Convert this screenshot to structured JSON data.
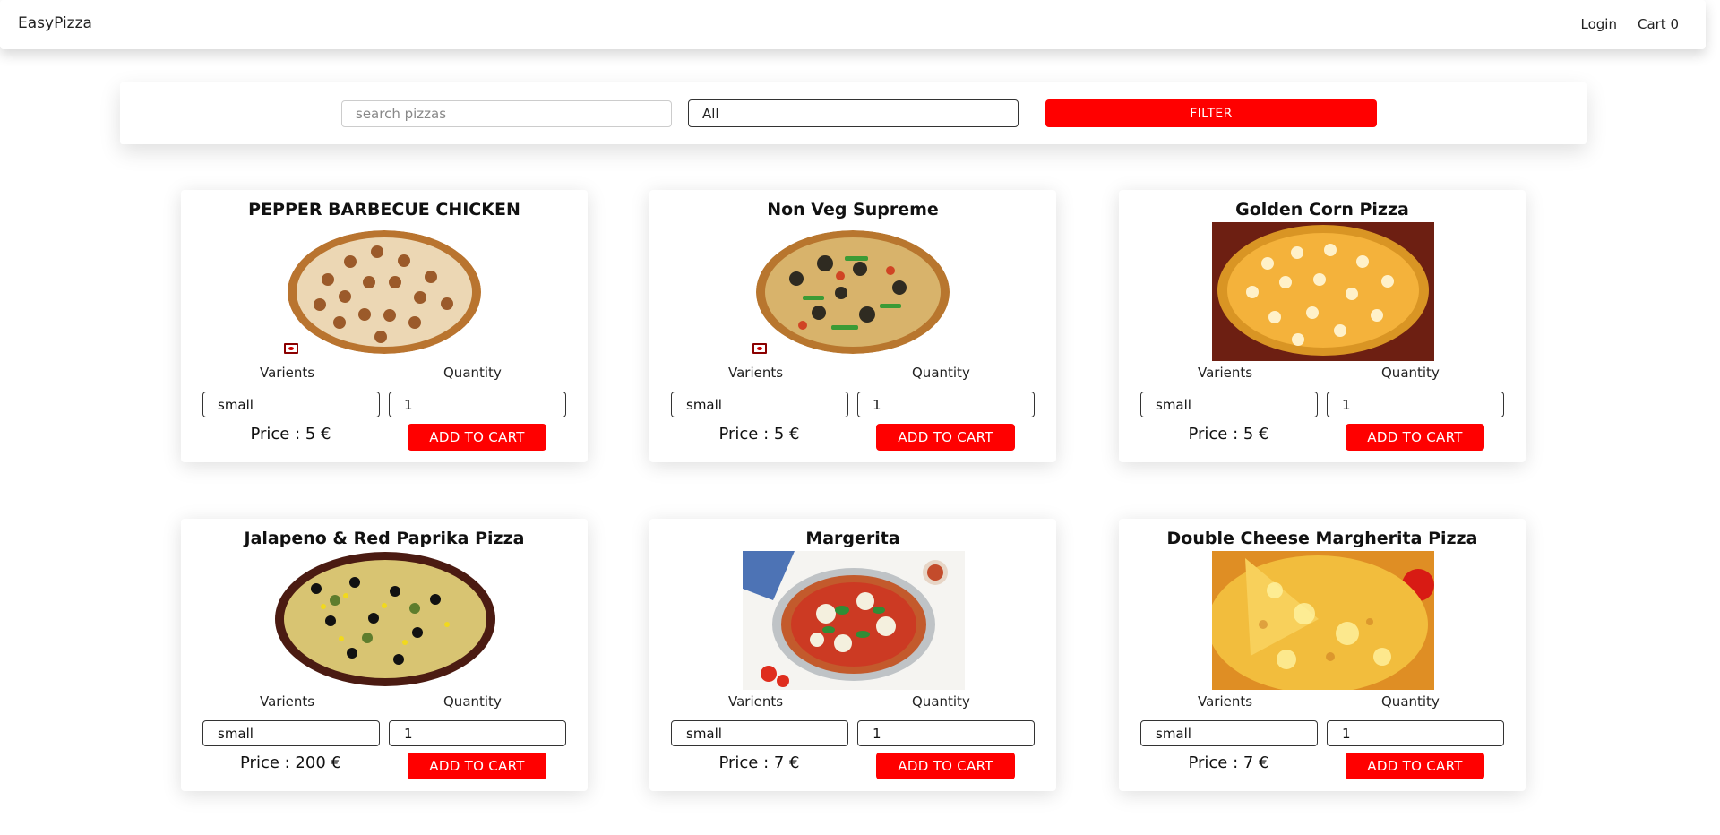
{
  "nav": {
    "brand": "EasyPizza",
    "login": "Login",
    "cart": "Cart 0"
  },
  "filter": {
    "search_placeholder": "search pizzas",
    "search_value": "",
    "category_value": "All",
    "button_label": "FILTER"
  },
  "labels": {
    "varients": "Varients",
    "quantity": "Quantity",
    "add_to_cart": "ADD TO CART"
  },
  "pizzas": [
    {
      "name": "PEPPER BARBECUE CHICKEN",
      "variant": "small",
      "quantity": "1",
      "price": "Price : 5 €",
      "image": "pepper-barbecue-chicken"
    },
    {
      "name": "Non Veg Supreme",
      "variant": "small",
      "quantity": "1",
      "price": "Price : 5 €",
      "image": "non-veg-supreme"
    },
    {
      "name": "Golden Corn Pizza",
      "variant": "small",
      "quantity": "1",
      "price": "Price : 5 €",
      "image": "golden-corn-pizza"
    },
    {
      "name": "Jalapeno & Red Paprika Pizza",
      "variant": "small",
      "quantity": "1",
      "price": "Price : 200 €",
      "image": "jalapeno-red-paprika-pizza"
    },
    {
      "name": "Margerita",
      "variant": "small",
      "quantity": "1",
      "price": "Price : 7 €",
      "image": "margerita"
    },
    {
      "name": "Double Cheese Margherita Pizza",
      "variant": "small",
      "quantity": "1",
      "price": "Price : 7 €",
      "image": "double-cheese-margherita-pizza"
    }
  ],
  "colors": {
    "accent": "#ff0000",
    "card_background": "#ffffff"
  }
}
